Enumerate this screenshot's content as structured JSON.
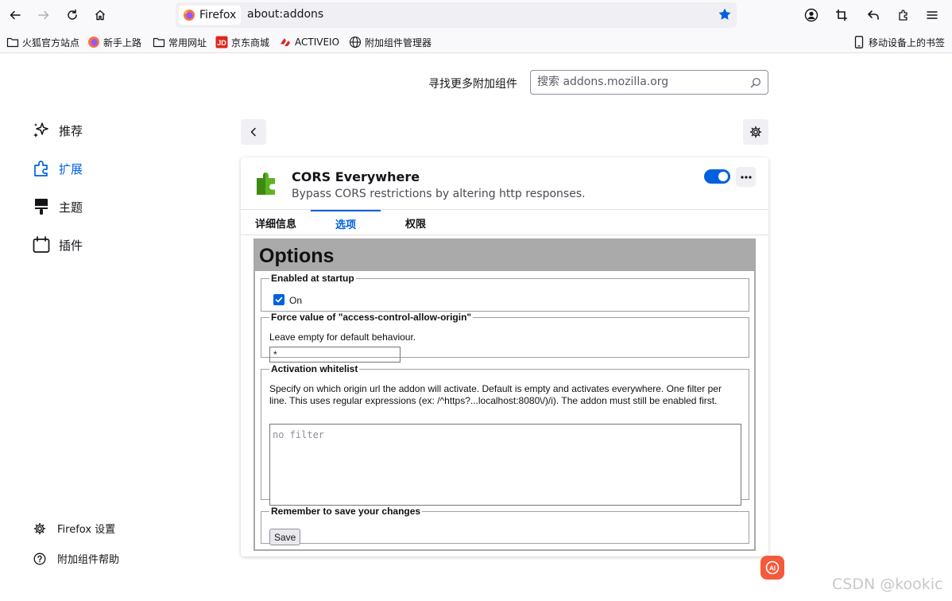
{
  "browser": {
    "tab_title": "Firefox",
    "url": "about:addons",
    "icons": [
      "back-icon",
      "forward-icon",
      "reload-icon",
      "home-icon",
      "star-icon",
      "account-icon",
      "screenshot-icon",
      "undo-icon",
      "extensions-icon",
      "menu-icon"
    ],
    "accent": "#0061e0"
  },
  "bookmarks": {
    "items": [
      {
        "label": "火狐官方站点",
        "icon": "folder-icon"
      },
      {
        "label": "新手上路",
        "icon": "firefox-icon"
      },
      {
        "label": "常用网址",
        "icon": "folder-icon"
      },
      {
        "label": "京东商城",
        "icon": "jd-icon"
      },
      {
        "label": "ACTIVEIO",
        "icon": "activeio-icon"
      },
      {
        "label": "附加组件管理器",
        "icon": "globe-icon"
      }
    ],
    "mobile_label": "移动设备上的书签"
  },
  "header": {
    "find_more": "寻找更多附加组件",
    "search_placeholder": "搜索 addons.mozilla.org"
  },
  "sidebar": {
    "categories": [
      {
        "label": "推荐",
        "icon": "sparkle-icon"
      },
      {
        "label": "扩展",
        "icon": "puzzle-icon",
        "active": true
      },
      {
        "label": "主题",
        "icon": "brush-icon"
      },
      {
        "label": "插件",
        "icon": "plugin-icon"
      }
    ],
    "footer": [
      {
        "label": "Firefox 设置",
        "icon": "gear-icon"
      },
      {
        "label": "附加组件帮助",
        "icon": "help-icon"
      }
    ]
  },
  "addon": {
    "name": "CORS Everywhere",
    "description": "Bypass CORS restrictions by altering http responses.",
    "enabled": true,
    "tabs": [
      {
        "label": "详细信息"
      },
      {
        "label": "选项",
        "active": true
      },
      {
        "label": "权限"
      }
    ]
  },
  "options": {
    "title": "Options",
    "startup": {
      "legend": "Enabled at startup",
      "checkbox_label": "On",
      "checked": true
    },
    "acao": {
      "legend": "Force value of \"access-control-allow-origin\"",
      "hint": "Leave empty for default behaviour.",
      "value": "*"
    },
    "whitelist": {
      "legend": "Activation whitelist",
      "hint": "Specify on which origin url the addon will activate. Default is empty and activates everywhere. One filter per line. This uses regular expressions (ex: /^https?...localhost:8080\\/)/i). The addon must still be enabled first.",
      "placeholder": "no filter"
    },
    "save": {
      "legend": "Remember to save your changes",
      "button": "Save"
    }
  },
  "watermark": "CSDN @kookic"
}
